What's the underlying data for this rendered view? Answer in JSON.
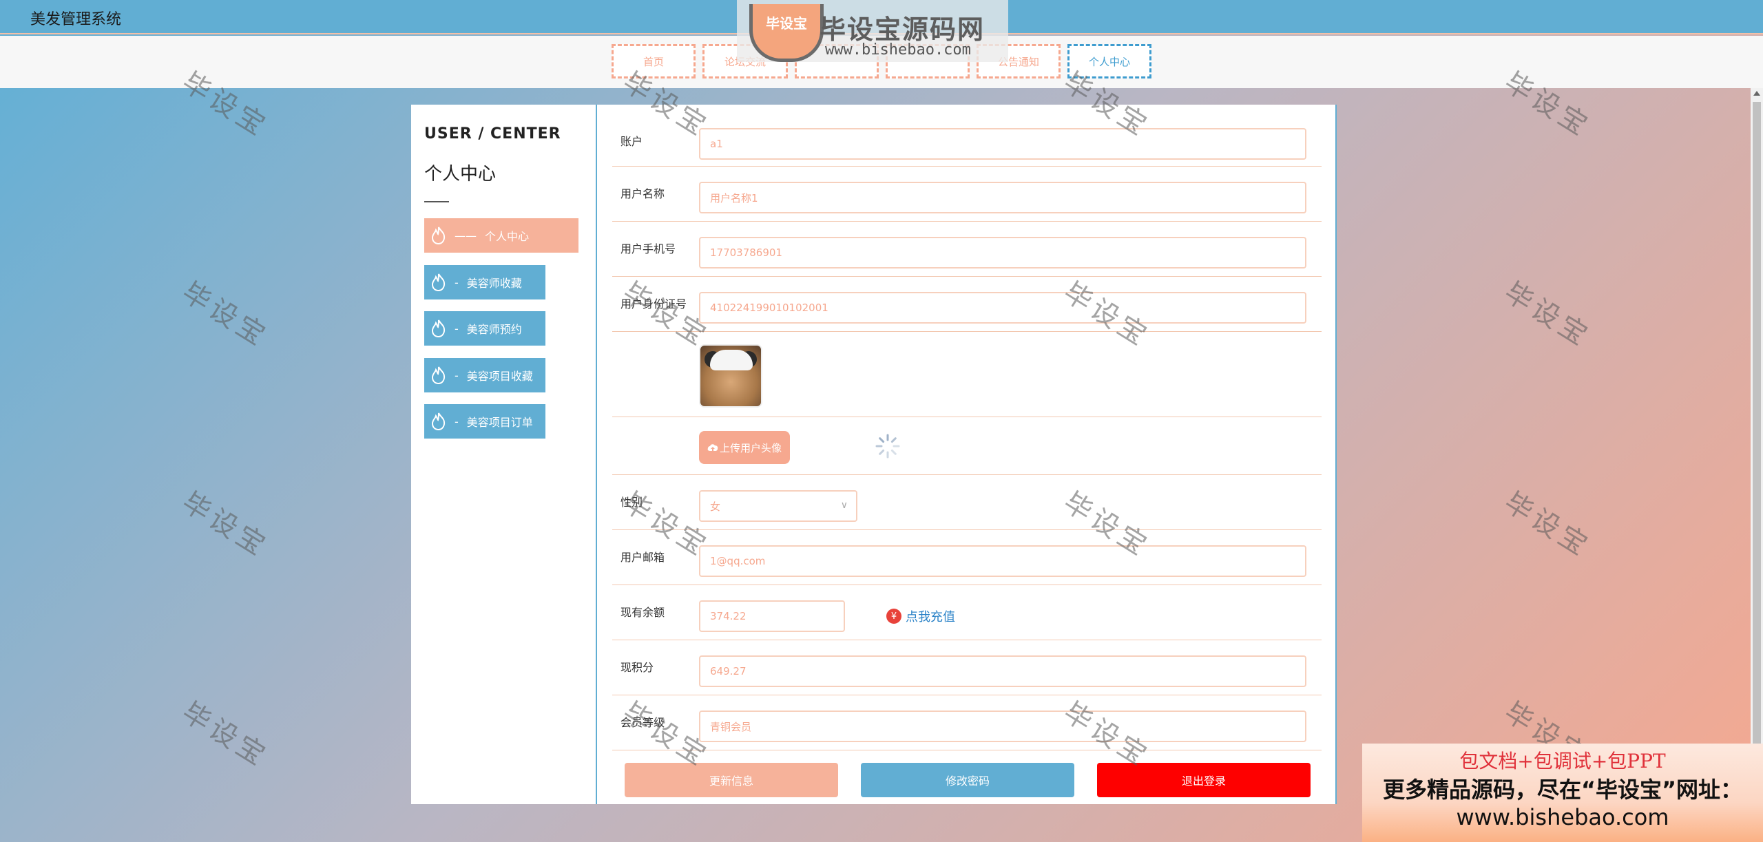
{
  "app": {
    "title": "美发管理系统"
  },
  "logo": {
    "badge": "毕设宝",
    "title": "毕设宝源码网",
    "url": "www.bishebao.com"
  },
  "nav": {
    "tabs": [
      {
        "label": "首页",
        "active": false
      },
      {
        "label": "论坛交流",
        "active": false
      },
      {
        "label": "",
        "active": false
      },
      {
        "label": "",
        "active": false
      },
      {
        "label": "公告通知",
        "active": false
      },
      {
        "label": "个人中心",
        "active": true
      }
    ]
  },
  "watermark": "毕设宝",
  "sidebar": {
    "title_en": "USER / CENTER",
    "title_cn": "个人中心",
    "items": [
      {
        "label": "个人中心",
        "active": true
      },
      {
        "label": "美容师收藏",
        "active": false
      },
      {
        "label": "美容师预约",
        "active": false
      },
      {
        "label": "美容项目收藏",
        "active": false
      },
      {
        "label": "美容项目订单",
        "active": false
      }
    ]
  },
  "form": {
    "account": {
      "label": "账户",
      "value": "a1"
    },
    "username": {
      "label": "用户名称",
      "value": "用户名称1"
    },
    "phone": {
      "label": "用户手机号",
      "value": "17703786901"
    },
    "idcard": {
      "label": "用户身份证号",
      "value": "410224199010102001"
    },
    "upload_label": "上传用户头像",
    "gender": {
      "label": "性别",
      "value": "女"
    },
    "email": {
      "label": "用户邮箱",
      "value": "1@qq.com"
    },
    "balance": {
      "label": "现有余额",
      "value": "374.22",
      "recharge": "点我充值",
      "coin": "¥"
    },
    "points": {
      "label": "现积分",
      "value": "649.27"
    },
    "level": {
      "label": "会员等级",
      "value": "青铜会员"
    }
  },
  "buttons": {
    "update": "更新信息",
    "change_password": "修改密码",
    "logout": "退出登录"
  },
  "ad": {
    "line1": "包文档+包调试+包PPT",
    "line2": "更多精品源码，尽在“毕设宝”网址：",
    "line3": "www.bishebao.com"
  },
  "colors": {
    "primary": "#61aed3",
    "accent": "#f6a88f",
    "logout": "#fe0000"
  }
}
